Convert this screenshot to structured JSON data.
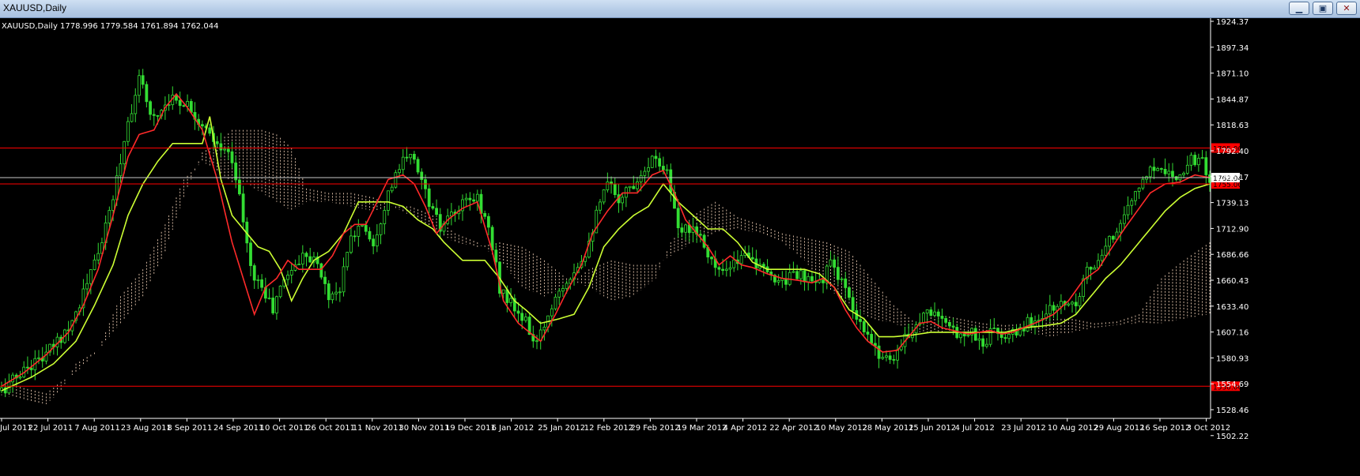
{
  "window": {
    "title": "XAUUSD,Daily",
    "buttons": [
      {
        "name": "minimize-button",
        "glyph": "▁"
      },
      {
        "name": "maximize-button",
        "glyph": "▣"
      },
      {
        "name": "close-button",
        "glyph": "✕"
      }
    ]
  },
  "ohlc_label": "XAUUSD,Daily  1778.996 1779.584 1761.894 1762.044",
  "colors": {
    "background": "#000000",
    "candle": "#33dd33",
    "tenkan": "#ff2a2a",
    "kijun": "#ccff33",
    "cloud_dots": "#e8c9b0",
    "hline": "#ff0000",
    "price_line": "#c8c8c8",
    "axis": "#ffffff"
  },
  "chart_data": {
    "type": "candlestick",
    "symbol": "XAUUSD",
    "timeframe": "Daily",
    "ylim": [
      1496,
      1935
    ],
    "y_ticks": [
      "1924.37",
      "1897.34",
      "1871.10",
      "1844.87",
      "1818.63",
      "1792.40",
      "1766.17",
      "1739.13",
      "1712.90",
      "1686.66",
      "1660.43",
      "1633.40",
      "1607.16",
      "1580.93",
      "1554.69",
      "1528.46",
      "1502.22"
    ],
    "x_ticks": [
      "Jul 2011",
      "22 Jul 2011",
      "7 Aug 2011",
      "23 Aug 2011",
      "8 Sep 2011",
      "24 Sep 2011",
      "10 Oct 2011",
      "26 Oct 2011",
      "11 Nov 2011",
      "30 Nov 2011",
      "19 Dec 2011",
      "6 Jan 2012",
      "25 Jan 2012",
      "12 Feb 2012",
      "29 Feb 2012",
      "19 Mar 2012",
      "4 Apr 2012",
      "22 Apr 2012",
      "10 May 2012",
      "28 May 2012",
      "15 Jun 2012",
      "4 Jul 2012",
      "23 Jul 2012",
      "10 Aug 2012",
      "29 Aug 2012",
      "16 Sep 2012",
      "3 Oct 2012"
    ],
    "horizontal_lines": [
      {
        "value": 1795.0,
        "label": "1795.00"
      },
      {
        "value": 1755.0,
        "label": "1755.00"
      },
      {
        "value": 1530.0,
        "label": "1530.00"
      }
    ],
    "current_price": {
      "value": 1762.04,
      "label": "1762.04"
    },
    "close_path": [
      [
        0,
        1525
      ],
      [
        7,
        1552
      ],
      [
        12,
        1565
      ],
      [
        16,
        1585
      ],
      [
        20,
        1612
      ],
      [
        24,
        1655
      ],
      [
        28,
        1705
      ],
      [
        31,
        1760
      ],
      [
        34,
        1825
      ],
      [
        37,
        1870
      ],
      [
        41,
        1828
      ],
      [
        45,
        1850
      ],
      [
        50,
        1845
      ],
      [
        54,
        1820
      ],
      [
        57,
        1800
      ],
      [
        62,
        1785
      ],
      [
        64,
        1740
      ],
      [
        67,
        1660
      ],
      [
        70,
        1640
      ],
      [
        73,
        1615
      ],
      [
        76,
        1650
      ],
      [
        79,
        1665
      ],
      [
        82,
        1680
      ],
      [
        85,
        1665
      ],
      [
        88,
        1630
      ],
      [
        91,
        1640
      ],
      [
        94,
        1695
      ],
      [
        97,
        1712
      ],
      [
        100,
        1690
      ],
      [
        104,
        1745
      ],
      [
        108,
        1780
      ],
      [
        111,
        1785
      ],
      [
        114,
        1745
      ],
      [
        118,
        1705
      ],
      [
        121,
        1718
      ],
      [
        125,
        1735
      ],
      [
        128,
        1740
      ],
      [
        131,
        1705
      ],
      [
        134,
        1640
      ],
      [
        138,
        1615
      ],
      [
        141,
        1600
      ],
      [
        144,
        1575
      ],
      [
        147,
        1610
      ],
      [
        150,
        1640
      ],
      [
        154,
        1660
      ],
      [
        157,
        1680
      ],
      [
        160,
        1720
      ],
      [
        163,
        1755
      ],
      [
        166,
        1740
      ],
      [
        170,
        1755
      ],
      [
        173,
        1775
      ],
      [
        176,
        1785
      ],
      [
        179,
        1770
      ],
      [
        182,
        1700
      ],
      [
        186,
        1710
      ],
      [
        189,
        1690
      ],
      [
        192,
        1660
      ],
      [
        195,
        1655
      ],
      [
        198,
        1670
      ],
      [
        201,
        1680
      ],
      [
        204,
        1660
      ],
      [
        207,
        1650
      ],
      [
        211,
        1650
      ],
      [
        214,
        1655
      ],
      [
        217,
        1645
      ],
      [
        220,
        1645
      ],
      [
        223,
        1665
      ],
      [
        226,
        1650
      ],
      [
        229,
        1610
      ],
      [
        232,
        1590
      ],
      [
        235,
        1570
      ],
      [
        239,
        1560
      ],
      [
        242,
        1575
      ],
      [
        245,
        1595
      ],
      [
        248,
        1610
      ],
      [
        251,
        1615
      ],
      [
        254,
        1595
      ],
      [
        257,
        1590
      ],
      [
        261,
        1590
      ],
      [
        264,
        1575
      ],
      [
        267,
        1595
      ],
      [
        270,
        1580
      ],
      [
        273,
        1590
      ],
      [
        276,
        1600
      ],
      [
        279,
        1605
      ],
      [
        282,
        1615
      ],
      [
        285,
        1620
      ],
      [
        289,
        1625
      ],
      [
        292,
        1660
      ],
      [
        295,
        1665
      ],
      [
        298,
        1690
      ],
      [
        301,
        1715
      ],
      [
        304,
        1735
      ],
      [
        307,
        1760
      ],
      [
        310,
        1775
      ],
      [
        313,
        1770
      ],
      [
        317,
        1765
      ],
      [
        320,
        1785
      ],
      [
        323,
        1778
      ],
      [
        325,
        1762
      ]
    ],
    "tenkan_path": [
      [
        0,
        1530
      ],
      [
        6,
        1545
      ],
      [
        12,
        1565
      ],
      [
        18,
        1590
      ],
      [
        22,
        1620
      ],
      [
        26,
        1660
      ],
      [
        30,
        1720
      ],
      [
        34,
        1785
      ],
      [
        37,
        1810
      ],
      [
        41,
        1815
      ],
      [
        44,
        1840
      ],
      [
        47,
        1855
      ],
      [
        50,
        1840
      ],
      [
        54,
        1815
      ],
      [
        58,
        1760
      ],
      [
        62,
        1690
      ],
      [
        65,
        1650
      ],
      [
        68,
        1610
      ],
      [
        71,
        1640
      ],
      [
        74,
        1650
      ],
      [
        77,
        1670
      ],
      [
        80,
        1660
      ],
      [
        83,
        1660
      ],
      [
        86,
        1660
      ],
      [
        89,
        1675
      ],
      [
        92,
        1700
      ],
      [
        95,
        1710
      ],
      [
        98,
        1710
      ],
      [
        101,
        1735
      ],
      [
        104,
        1760
      ],
      [
        108,
        1765
      ],
      [
        111,
        1755
      ],
      [
        114,
        1730
      ],
      [
        117,
        1700
      ],
      [
        120,
        1715
      ],
      [
        124,
        1728
      ],
      [
        128,
        1735
      ],
      [
        132,
        1680
      ],
      [
        135,
        1625
      ],
      [
        139,
        1600
      ],
      [
        142,
        1590
      ],
      [
        145,
        1580
      ],
      [
        149,
        1610
      ],
      [
        152,
        1635
      ],
      [
        156,
        1665
      ],
      [
        159,
        1700
      ],
      [
        163,
        1725
      ],
      [
        167,
        1745
      ],
      [
        171,
        1745
      ],
      [
        175,
        1765
      ],
      [
        178,
        1770
      ],
      [
        181,
        1745
      ],
      [
        184,
        1715
      ],
      [
        187,
        1700
      ],
      [
        190,
        1685
      ],
      [
        193,
        1665
      ],
      [
        196,
        1675
      ],
      [
        199,
        1665
      ],
      [
        202,
        1662
      ],
      [
        206,
        1655
      ],
      [
        210,
        1650
      ],
      [
        214,
        1648
      ],
      [
        218,
        1645
      ],
      [
        221,
        1650
      ],
      [
        224,
        1640
      ],
      [
        227,
        1615
      ],
      [
        230,
        1595
      ],
      [
        233,
        1580
      ],
      [
        237,
        1568
      ],
      [
        241,
        1570
      ],
      [
        244,
        1585
      ],
      [
        247,
        1600
      ],
      [
        250,
        1602
      ],
      [
        253,
        1595
      ],
      [
        256,
        1592
      ],
      [
        260,
        1588
      ],
      [
        263,
        1590
      ],
      [
        266,
        1592
      ],
      [
        269,
        1588
      ],
      [
        272,
        1590
      ],
      [
        276,
        1597
      ],
      [
        279,
        1602
      ],
      [
        283,
        1610
      ],
      [
        287,
        1625
      ],
      [
        291,
        1648
      ],
      [
        295,
        1660
      ],
      [
        298,
        1680
      ],
      [
        302,
        1705
      ],
      [
        306,
        1728
      ],
      [
        309,
        1745
      ],
      [
        313,
        1755
      ],
      [
        317,
        1757
      ],
      [
        321,
        1765
      ],
      [
        325,
        1762
      ]
    ],
    "kijun_path": [
      [
        0,
        1525
      ],
      [
        8,
        1540
      ],
      [
        14,
        1555
      ],
      [
        20,
        1580
      ],
      [
        25,
        1620
      ],
      [
        30,
        1665
      ],
      [
        34,
        1720
      ],
      [
        38,
        1755
      ],
      [
        42,
        1780
      ],
      [
        46,
        1800
      ],
      [
        50,
        1800
      ],
      [
        54,
        1800
      ],
      [
        56,
        1830
      ],
      [
        59,
        1760
      ],
      [
        62,
        1720
      ],
      [
        66,
        1700
      ],
      [
        69,
        1685
      ],
      [
        72,
        1680
      ],
      [
        75,
        1660
      ],
      [
        78,
        1625
      ],
      [
        81,
        1650
      ],
      [
        84,
        1670
      ],
      [
        88,
        1680
      ],
      [
        92,
        1700
      ],
      [
        96,
        1735
      ],
      [
        100,
        1735
      ],
      [
        104,
        1735
      ],
      [
        108,
        1730
      ],
      [
        112,
        1715
      ],
      [
        116,
        1705
      ],
      [
        119,
        1690
      ],
      [
        124,
        1670
      ],
      [
        130,
        1670
      ],
      [
        134,
        1650
      ],
      [
        138,
        1625
      ],
      [
        141,
        1615
      ],
      [
        145,
        1600
      ],
      [
        150,
        1605
      ],
      [
        154,
        1610
      ],
      [
        158,
        1640
      ],
      [
        162,
        1685
      ],
      [
        166,
        1705
      ],
      [
        170,
        1720
      ],
      [
        174,
        1730
      ],
      [
        178,
        1755
      ],
      [
        182,
        1735
      ],
      [
        186,
        1720
      ],
      [
        190,
        1705
      ],
      [
        194,
        1705
      ],
      [
        198,
        1690
      ],
      [
        202,
        1668
      ],
      [
        206,
        1660
      ],
      [
        211,
        1660
      ],
      [
        216,
        1660
      ],
      [
        220,
        1655
      ],
      [
        224,
        1640
      ],
      [
        228,
        1615
      ],
      [
        232,
        1605
      ],
      [
        236,
        1585
      ],
      [
        240,
        1585
      ],
      [
        245,
        1587
      ],
      [
        250,
        1590
      ],
      [
        255,
        1590
      ],
      [
        260,
        1590
      ],
      [
        265,
        1590
      ],
      [
        270,
        1590
      ],
      [
        275,
        1595
      ],
      [
        280,
        1597
      ],
      [
        285,
        1600
      ],
      [
        289,
        1610
      ],
      [
        293,
        1630
      ],
      [
        297,
        1650
      ],
      [
        301,
        1665
      ],
      [
        305,
        1685
      ],
      [
        309,
        1705
      ],
      [
        313,
        1725
      ],
      [
        317,
        1740
      ],
      [
        321,
        1750
      ],
      [
        325,
        1755
      ]
    ],
    "span_a_path": [
      [
        0,
        1535
      ],
      [
        6,
        1528
      ],
      [
        12,
        1522
      ],
      [
        16,
        1535
      ],
      [
        20,
        1545
      ],
      [
        26,
        1570
      ],
      [
        32,
        1600
      ],
      [
        38,
        1630
      ],
      [
        44,
        1680
      ],
      [
        49,
        1740
      ],
      [
        54,
        1790
      ],
      [
        58,
        1800
      ],
      [
        62,
        1815
      ],
      [
        66,
        1815
      ],
      [
        70,
        1815
      ],
      [
        74,
        1810
      ],
      [
        78,
        1795
      ],
      [
        82,
        1750
      ],
      [
        88,
        1745
      ],
      [
        94,
        1745
      ],
      [
        100,
        1740
      ],
      [
        105,
        1730
      ],
      [
        110,
        1720
      ],
      [
        116,
        1705
      ],
      [
        122,
        1690
      ],
      [
        128,
        1685
      ],
      [
        134,
        1690
      ],
      [
        140,
        1685
      ],
      [
        146,
        1670
      ],
      [
        152,
        1650
      ],
      [
        158,
        1640
      ],
      [
        164,
        1625
      ],
      [
        170,
        1630
      ],
      [
        176,
        1650
      ],
      [
        180,
        1690
      ],
      [
        186,
        1720
      ],
      [
        192,
        1735
      ],
      [
        198,
        1718
      ],
      [
        204,
        1710
      ],
      [
        210,
        1700
      ],
      [
        216,
        1695
      ],
      [
        222,
        1690
      ],
      [
        228,
        1680
      ],
      [
        234,
        1650
      ],
      [
        240,
        1620
      ],
      [
        246,
        1600
      ],
      [
        252,
        1610
      ],
      [
        258,
        1605
      ],
      [
        264,
        1600
      ],
      [
        270,
        1598
      ],
      [
        276,
        1600
      ],
      [
        282,
        1605
      ],
      [
        288,
        1605
      ],
      [
        294,
        1600
      ],
      [
        300,
        1602
      ],
      [
        306,
        1610
      ],
      [
        312,
        1650
      ],
      [
        318,
        1670
      ],
      [
        325,
        1690
      ]
    ],
    "span_b_path": [
      [
        0,
        1520
      ],
      [
        6,
        1515
      ],
      [
        12,
        1510
      ],
      [
        16,
        1525
      ],
      [
        20,
        1555
      ],
      [
        26,
        1570
      ],
      [
        32,
        1630
      ],
      [
        38,
        1660
      ],
      [
        44,
        1710
      ],
      [
        49,
        1760
      ],
      [
        54,
        1780
      ],
      [
        58,
        1770
      ],
      [
        62,
        1755
      ],
      [
        66,
        1755
      ],
      [
        70,
        1745
      ],
      [
        74,
        1735
      ],
      [
        78,
        1725
      ],
      [
        82,
        1735
      ],
      [
        88,
        1735
      ],
      [
        94,
        1730
      ],
      [
        100,
        1725
      ],
      [
        105,
        1730
      ],
      [
        110,
        1730
      ],
      [
        116,
        1720
      ],
      [
        122,
        1700
      ],
      [
        128,
        1690
      ],
      [
        134,
        1670
      ],
      [
        140,
        1640
      ],
      [
        146,
        1630
      ],
      [
        152,
        1640
      ],
      [
        158,
        1660
      ],
      [
        164,
        1670
      ],
      [
        170,
        1665
      ],
      [
        176,
        1665
      ],
      [
        180,
        1675
      ],
      [
        186,
        1690
      ],
      [
        192,
        1700
      ],
      [
        198,
        1705
      ],
      [
        204,
        1700
      ],
      [
        210,
        1690
      ],
      [
        216,
        1670
      ],
      [
        222,
        1640
      ],
      [
        228,
        1620
      ],
      [
        234,
        1605
      ],
      [
        240,
        1600
      ],
      [
        246,
        1590
      ],
      [
        252,
        1590
      ],
      [
        258,
        1590
      ],
      [
        264,
        1590
      ],
      [
        270,
        1590
      ],
      [
        276,
        1590
      ],
      [
        282,
        1585
      ],
      [
        288,
        1590
      ],
      [
        294,
        1595
      ],
      [
        300,
        1598
      ],
      [
        306,
        1600
      ],
      [
        312,
        1600
      ],
      [
        318,
        1605
      ],
      [
        325,
        1610
      ]
    ]
  }
}
